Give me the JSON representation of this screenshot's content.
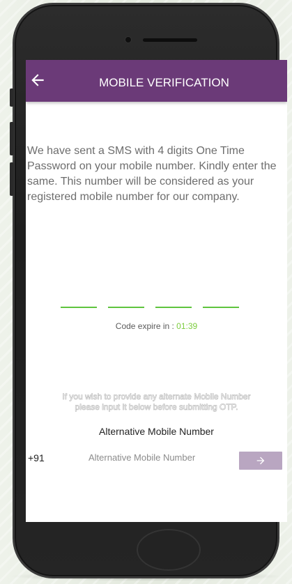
{
  "appbar": {
    "title": "MOBILE VERIFICATION",
    "back_icon": "arrow-left-icon"
  },
  "message": "We have sent a SMS with 4 digits One Time Password on your mobile number. Kindly enter the same. This number will be considered as your registered mobile number for our company.",
  "otp": {
    "digits": [
      "",
      "",
      "",
      ""
    ]
  },
  "expire": {
    "label": "Code expire in : ",
    "timer": "01:39"
  },
  "alternate": {
    "note_line1": "If you wish to provide any alternate Mobile Number",
    "note_line2": "please input it below before submitting OTP.",
    "title": "Alternative Mobile Number",
    "prefix": "+91",
    "placeholder": "Alternative Mobile Number",
    "submit_icon": "arrow-right-icon"
  },
  "colors": {
    "appbar": "#6b3a78",
    "otp_underline": "#5fc43d",
    "timer": "#7ccc3e",
    "submit_button": "#b9a6c1"
  }
}
